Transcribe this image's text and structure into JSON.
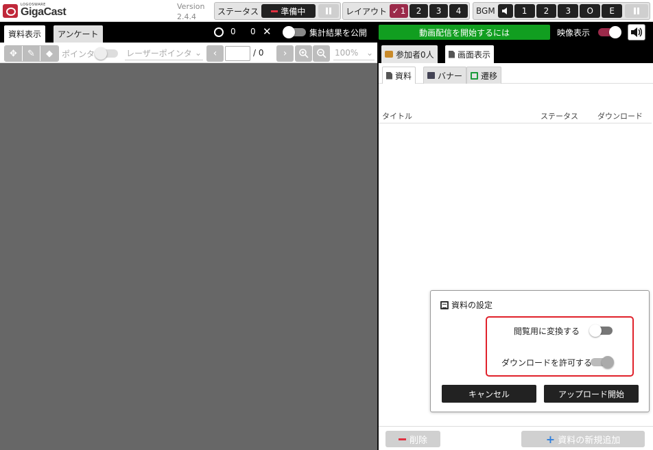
{
  "app": {
    "logo_small": "LOGOSWARE",
    "logo_text": "GigaCast",
    "version_label": "Version",
    "version": "2.4.4"
  },
  "status": {
    "label": "ステータス",
    "value": "準備中"
  },
  "layout": {
    "label": "レイアウト",
    "options": [
      "1",
      "2",
      "3",
      "4"
    ],
    "selected": "1"
  },
  "bgm": {
    "label": "BGM",
    "options": [
      "1",
      "2",
      "3",
      "O",
      "E"
    ]
  },
  "left_tabs": [
    "資料表示",
    "アンケート"
  ],
  "counters": {
    "circle_count": "0",
    "x_count": "0"
  },
  "publish_results": {
    "label": "集計結果を公開",
    "on": false
  },
  "stream_button": "動画配信を開始するには",
  "video_display": {
    "label": "映像表示",
    "on": true,
    "accent": "#9b2a4a"
  },
  "toolbar": {
    "pointer_label": "ポインタ",
    "laser_pointer": "レーザーポインタ",
    "page_total": "/ 0",
    "zoom": "100%"
  },
  "right_tabs": {
    "participants": "参加者0人",
    "screen": "画面表示"
  },
  "sub_tabs": [
    "資料",
    "バナー",
    "遷移"
  ],
  "table": {
    "headers": [
      "タイトル",
      "ステータス",
      "ダウンロード"
    ],
    "rows": []
  },
  "bottom": {
    "delete_label": "削除",
    "add_label": "資料の新規追加"
  },
  "dialog": {
    "title": "資料の設定",
    "options": [
      {
        "label": "閲覧用に変換する",
        "on": false
      },
      {
        "label": "ダウンロードを許可する",
        "on": false
      }
    ],
    "cancel_label": "キャンセル",
    "upload_label": "アップロード開始"
  },
  "colors": {
    "stream_green": "#119e20",
    "accent": "#9b2a4a",
    "highlight_red": "#e0202a"
  }
}
